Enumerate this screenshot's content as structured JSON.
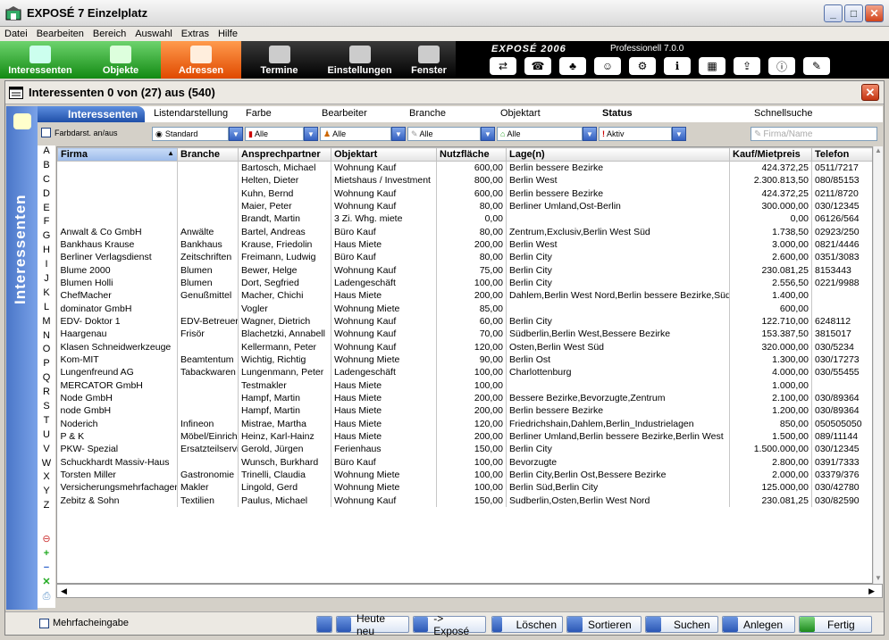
{
  "window": {
    "title": "EXPOSÉ 7 Einzelplatz"
  },
  "menu": [
    "Datei",
    "Bearbeiten",
    "Bereich",
    "Auswahl",
    "Extras",
    "Hilfe"
  ],
  "toolbar": {
    "buttons": [
      "Interessenten",
      "Objekte",
      "Adressen",
      "Termine",
      "Einstellungen",
      "Fenster"
    ],
    "brand": "EXPOSÉ 2006",
    "edition": "Professionell 7.0.0"
  },
  "subwindow": {
    "title": "Interessenten  0 von (27) aus (540)"
  },
  "sidepanel": {
    "label": "Interessenten"
  },
  "tabs": {
    "active": "Interessenten",
    "labels": [
      "Listendarstellung",
      "Farbe",
      "Bearbeiter",
      "Branche",
      "Objektart",
      "Status",
      "Schnellsuche"
    ]
  },
  "filters": {
    "color_toggle": "Farbdarst. an/aus",
    "listview": "Standard",
    "farbe": "Alle",
    "bearbeiter": "Alle",
    "branche": "Alle",
    "objektart": "Alle",
    "status": "Aktiv",
    "search_placeholder": "Firma/Name"
  },
  "letters": [
    "A",
    "B",
    "C",
    "D",
    "E",
    "F",
    "G",
    "H",
    "I",
    "J",
    "K",
    "L",
    "M",
    "N",
    "O",
    "P",
    "Q",
    "R",
    "S",
    "T",
    "U",
    "V",
    "W",
    "X",
    "Y",
    "Z"
  ],
  "table": {
    "headers": [
      "Firma",
      "Branche",
      "Ansprechpartner",
      "Objektart",
      "Nutzfläche",
      "Lage(n)",
      "Kauf/Mietpreis",
      "Telefon"
    ],
    "rows": [
      [
        "",
        "",
        "Bartosch, Michael",
        "Wohnung Kauf",
        "600,00",
        "Berlin bessere Bezirke",
        "424.372,25",
        "0511/7217"
      ],
      [
        "",
        "",
        "Helten, Dieter",
        "Mietshaus / Investment",
        "800,00",
        "Berlin West",
        "2.300.813,50",
        "080/85153"
      ],
      [
        "",
        "",
        "Kuhn, Bernd",
        "Wohnung Kauf",
        "600,00",
        "Berlin bessere Bezirke",
        "424.372,25",
        "0211/8720"
      ],
      [
        "",
        "",
        "Maier, Peter",
        "Wohnung Kauf",
        "80,00",
        "Berliner Umland,Ost-Berlin",
        "300.000,00",
        "030/12345"
      ],
      [
        "",
        "",
        "Brandt, Martin",
        "3 Zi. Whg. miete",
        "0,00",
        "",
        "0,00",
        "06126/564"
      ],
      [
        "Anwalt & Co GmbH",
        "Anwälte",
        "Bartel, Andreas",
        "Büro Kauf",
        "80,00",
        "Zentrum,Exclusiv,Berlin West Süd",
        "1.738,50",
        "02923/250"
      ],
      [
        "Bankhaus Krause",
        "Bankhaus",
        "Krause, Friedolin",
        "Haus Miete",
        "200,00",
        "Berlin West",
        "3.000,00",
        "0821/4446"
      ],
      [
        "Berliner Verlagsdienst",
        "Zeitschriften",
        "Freimann, Ludwig",
        "Büro Kauf",
        "80,00",
        "Berlin City",
        "2.600,00",
        "0351/3083"
      ],
      [
        "Blume 2000",
        "Blumen",
        "Bewer, Helge",
        "Wohnung Kauf",
        "75,00",
        "Berlin City",
        "230.081,25",
        "8153443"
      ],
      [
        "Blumen Holli",
        "Blumen",
        "Dort, Segfried",
        "Ladengeschäft",
        "100,00",
        "Berlin City",
        "2.556,50",
        "0221/9988"
      ],
      [
        "ChefMacher",
        "Genußmittel",
        "Macher, Chichi",
        "Haus Miete",
        "200,00",
        "Dahlem,Berlin West Nord,Berlin bessere Bezirke,Süd",
        "1.400,00",
        ""
      ],
      [
        "dominator GmbH",
        "",
        "Vogler",
        "Wohnung Miete",
        "85,00",
        "",
        "600,00",
        ""
      ],
      [
        "EDV- Doktor 1",
        "EDV-Betreuer",
        "Wagner, Dietrich",
        "Wohnung Kauf",
        "60,00",
        "Berlin City",
        "122.710,00",
        "6248112"
      ],
      [
        "Haargenau",
        "Frisör",
        "Blachetzki, Annabell",
        "Wohnung Kauf",
        "70,00",
        "Südberlin,Berlin West,Bessere Bezirke",
        "153.387,50",
        "3815017"
      ],
      [
        "Klasen Schneidwerkzeuge",
        "",
        "Kellermann, Peter",
        "Wohnung Kauf",
        "120,00",
        "Osten,Berlin West Süd",
        "320.000,00",
        "030/5234"
      ],
      [
        "Kom-MIT",
        "Beamtentum",
        "Wichtig, Richtig",
        "Wohnung Miete",
        "90,00",
        "Berlin Ost",
        "1.300,00",
        "030/17273"
      ],
      [
        "Lungenfreund AG",
        "Tabackwaren",
        "Lungenmann, Peter",
        "Ladengeschäft",
        "100,00",
        "Charlottenburg",
        "4.000,00",
        "030/55455"
      ],
      [
        "MERCATOR GmbH",
        "",
        "Testmakler",
        "Haus Miete",
        "100,00",
        "",
        "1.000,00",
        ""
      ],
      [
        "Node GmbH",
        "",
        "Hampf, Martin",
        "Haus Miete",
        "200,00",
        "Bessere Bezirke,Bevorzugte,Zentrum",
        "2.100,00",
        "030/89364"
      ],
      [
        "node GmbH",
        "",
        "Hampf, Martin",
        "Haus Miete",
        "200,00",
        "Berlin bessere Bezirke",
        "1.200,00",
        "030/89364"
      ],
      [
        "Noderich",
        "Infineon",
        "Mistrae, Martha",
        "Haus Miete",
        "120,00",
        "Friedrichshain,Dahlem,Berlin_Industrielagen",
        "850,00",
        "050505050"
      ],
      [
        "P & K",
        "Möbel/Einrich",
        "Heinz, Karl-Hainz",
        "Haus Miete",
        "200,00",
        "Berliner Umland,Berlin bessere Bezirke,Berlin West",
        "1.500,00",
        "089/11144"
      ],
      [
        "PKW- Spezial",
        "Ersatzteilservic",
        "Gerold, Jürgen",
        "Ferienhaus",
        "150,00",
        "Berlin City",
        "1.500.000,00",
        "030/12345"
      ],
      [
        "Schuckhardt Massiv-Haus",
        "",
        "Wunsch, Burkhard",
        "Büro Kauf",
        "100,00",
        "Bevorzugte",
        "2.800,00",
        "0391/7333"
      ],
      [
        "Torsten Miller",
        "Gastronomie",
        "Trinelli, Claudia",
        "Wohnung Miete",
        "100,00",
        "Berlin City,Berlin Ost,Bessere Bezirke",
        "2.000,00",
        "03379/376"
      ],
      [
        "Versicherungsmehrfachagen",
        "Makler",
        "Lingold, Gerd",
        "Wohnung Miete",
        "100,00",
        "Berlin Süd,Berlin City",
        "125.000,00",
        "030/42780"
      ],
      [
        "Zebitz & Sohn",
        "Textilien",
        "Paulus, Michael",
        "Wohnung Kauf",
        "150,00",
        "Sudberlin,Osten,Berlin West Nord",
        "230.081,25",
        "030/82590"
      ]
    ]
  },
  "bottom": {
    "multi_entry": "Mehrfacheingabe",
    "buttons": [
      "Heute neu",
      "-> Exposé",
      "Löschen",
      "Sortieren",
      "Suchen",
      "Anlegen",
      "Fertig"
    ]
  }
}
